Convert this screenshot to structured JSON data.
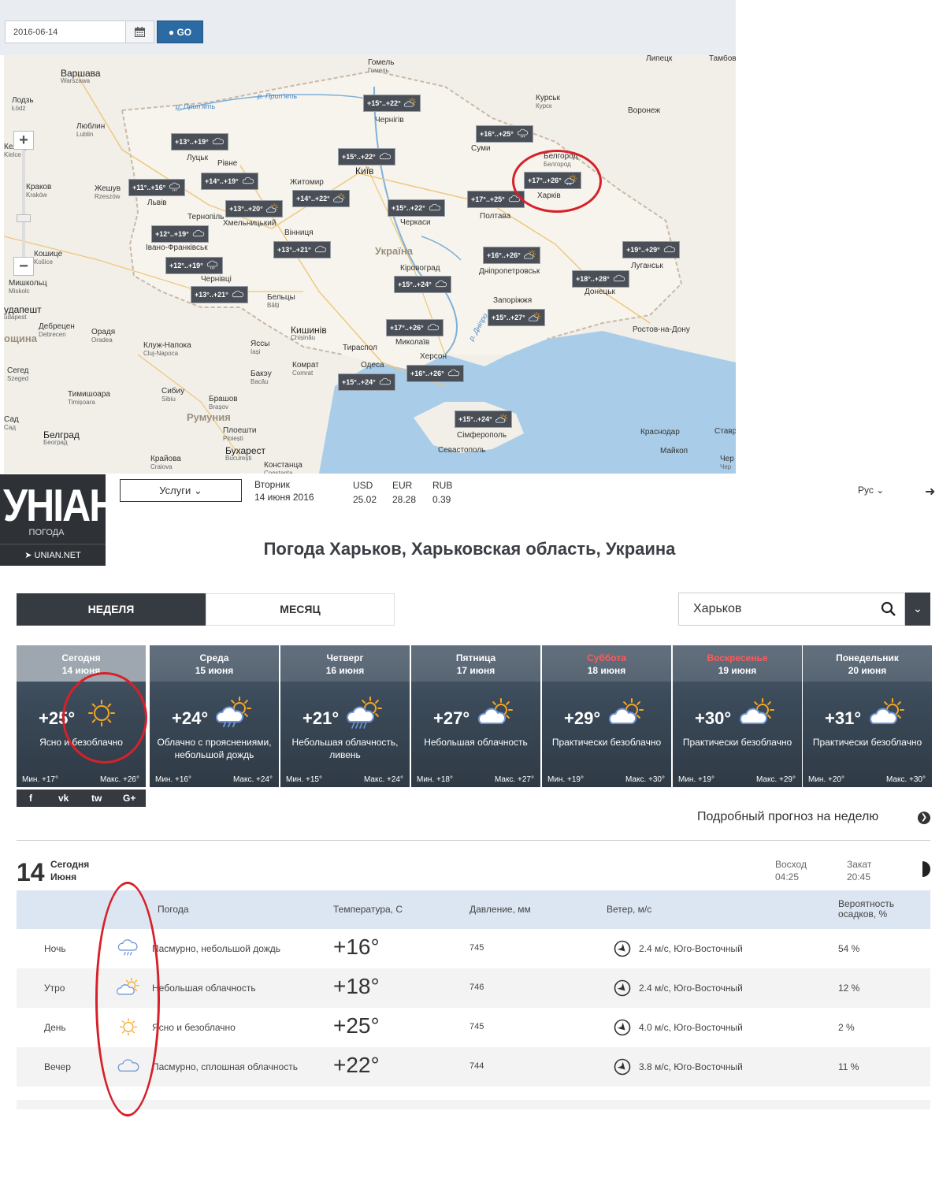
{
  "date_picker": {
    "value": "2016-06-14",
    "go_label": "GO"
  },
  "map": {
    "cities": [
      {
        "name": "Варшава",
        "sub": "Warszawa",
        "cls": "big"
      },
      {
        "name": "Лодзь",
        "sub": "Łódź",
        "cls": ""
      },
      {
        "name": "Люблин",
        "sub": "Lublin",
        "cls": ""
      },
      {
        "name": "Кельце",
        "sub": "Kielce",
        "cls": ""
      },
      {
        "name": "Краков",
        "sub": "Kraków",
        "cls": ""
      },
      {
        "name": "Жешув",
        "sub": "Rzeszów",
        "cls": ""
      },
      {
        "name": "Кошице",
        "sub": "Košice",
        "cls": ""
      },
      {
        "name": "Мишкольц",
        "sub": "Miskolc",
        "cls": ""
      },
      {
        "name": "удапешт",
        "sub": "udapest",
        "cls": "big"
      },
      {
        "name": "Дебрецен",
        "sub": "Debrecen",
        "cls": ""
      },
      {
        "name": "Орадя",
        "sub": "Oradea",
        "cls": ""
      },
      {
        "name": "Сегед",
        "sub": "Szeged",
        "cls": ""
      },
      {
        "name": "Тимишоара",
        "sub": "Timișoara",
        "cls": ""
      },
      {
        "name": "Белград",
        "sub": "Београд",
        "cls": "big"
      },
      {
        "name": "Клуж-Напока",
        "sub": "Cluj-Napoca",
        "cls": ""
      },
      {
        "name": "Сибиу",
        "sub": "Sibiu",
        "cls": ""
      },
      {
        "name": "Брашов",
        "sub": "Brașov",
        "cls": ""
      },
      {
        "name": "Румуния",
        "sub": "",
        "cls": "country"
      },
      {
        "name": "Плоешти",
        "sub": "Ploiești",
        "cls": ""
      },
      {
        "name": "Бухарест",
        "sub": "București",
        "cls": "big"
      },
      {
        "name": "Крайова",
        "sub": "Craiova",
        "cls": ""
      },
      {
        "name": "Констанца",
        "sub": "Constanța",
        "cls": ""
      },
      {
        "name": "Луцьк",
        "sub": "",
        "cls": ""
      },
      {
        "name": "Рівне",
        "sub": "",
        "cls": ""
      },
      {
        "name": "Львів",
        "sub": "",
        "cls": ""
      },
      {
        "name": "Тернопіль",
        "sub": "",
        "cls": ""
      },
      {
        "name": "Хмельницький",
        "sub": "",
        "cls": ""
      },
      {
        "name": "Івано-Франківськ",
        "sub": "",
        "cls": ""
      },
      {
        "name": "Чернівці",
        "sub": "",
        "cls": ""
      },
      {
        "name": "Житомир",
        "sub": "",
        "cls": ""
      },
      {
        "name": "Вінниця",
        "sub": "",
        "cls": ""
      },
      {
        "name": "Київ",
        "sub": "",
        "cls": "big"
      },
      {
        "name": "Чернігів",
        "sub": "",
        "cls": ""
      },
      {
        "name": "Гомель",
        "sub": "Гомель",
        "cls": ""
      },
      {
        "name": "Україна",
        "sub": "",
        "cls": "country"
      },
      {
        "name": "Черкаси",
        "sub": "",
        "cls": ""
      },
      {
        "name": "Кіровоград",
        "sub": "",
        "cls": ""
      },
      {
        "name": "Миколаїв",
        "sub": "",
        "cls": ""
      },
      {
        "name": "Одеса",
        "sub": "",
        "cls": ""
      },
      {
        "name": "Херсон",
        "sub": "",
        "cls": ""
      },
      {
        "name": "Кишинів",
        "sub": "Chișinău",
        "cls": "big"
      },
      {
        "name": "Бельцы",
        "sub": "Bălți",
        "cls": ""
      },
      {
        "name": "Яссы",
        "sub": "Iași",
        "cls": ""
      },
      {
        "name": "Бакэу",
        "sub": "Bacău",
        "cls": ""
      },
      {
        "name": "Тираспол",
        "sub": "",
        "cls": ""
      },
      {
        "name": "Комрат",
        "sub": "Comrat",
        "cls": ""
      },
      {
        "name": "Суми",
        "sub": "",
        "cls": ""
      },
      {
        "name": "Курськ",
        "sub": "Курск",
        "cls": ""
      },
      {
        "name": "Белгород",
        "sub": "Белгород",
        "cls": ""
      },
      {
        "name": "Харків",
        "sub": "",
        "cls": ""
      },
      {
        "name": "Полтава",
        "sub": "",
        "cls": ""
      },
      {
        "name": "Дніпропетровськ",
        "sub": "",
        "cls": ""
      },
      {
        "name": "Запоріжжя",
        "sub": "",
        "cls": ""
      },
      {
        "name": "Донецьк",
        "sub": "",
        "cls": ""
      },
      {
        "name": "Луганськ",
        "sub": "",
        "cls": ""
      },
      {
        "name": "Воронеж",
        "sub": "",
        "cls": ""
      },
      {
        "name": "Ростов-на-Дону",
        "sub": "",
        "cls": ""
      },
      {
        "name": "Краснодар",
        "sub": "",
        "cls": ""
      },
      {
        "name": "Майкоп",
        "sub": "",
        "cls": ""
      },
      {
        "name": "Сімферополь",
        "sub": "",
        "cls": ""
      },
      {
        "name": "Севастополь",
        "sub": "",
        "cls": ""
      },
      {
        "name": "Липецк",
        "sub": "",
        "cls": ""
      },
      {
        "name": "Тамбов",
        "sub": "",
        "cls": ""
      },
      {
        "name": "Ставро",
        "sub": "",
        "cls": ""
      },
      {
        "name": "Чер",
        "sub": "Чер",
        "cls": ""
      },
      {
        "name": "Сад",
        "sub": "Сад",
        "cls": ""
      },
      {
        "name": "ощина",
        "sub": "",
        "cls": "country"
      }
    ],
    "rivers": [
      "р. Прип'ять",
      "р. Прип'ять",
      "р. Дніпро"
    ],
    "labels": [
      {
        "text": "+15°..+22°",
        "icon": "cloud-sun"
      },
      {
        "text": "+16°..+25°",
        "icon": "cloud-rain"
      },
      {
        "text": "+13°..+19°",
        "icon": "cloud"
      },
      {
        "text": "+15°..+22°",
        "icon": "cloud"
      },
      {
        "text": "+17°..+26°",
        "icon": "cloud-rain-sun"
      },
      {
        "text": "+11°..+16°",
        "icon": "cloud-rain"
      },
      {
        "text": "+14°..+19°",
        "icon": "cloud"
      },
      {
        "text": "+14°..+22°",
        "icon": "cloud-sun"
      },
      {
        "text": "+17°..+25°",
        "icon": "cloud"
      },
      {
        "text": "+13°..+20°",
        "icon": "cloud-sun"
      },
      {
        "text": "+15°..+22°",
        "icon": "cloud"
      },
      {
        "text": "+12°..+19°",
        "icon": "cloud"
      },
      {
        "text": "+13°..+21°",
        "icon": "cloud"
      },
      {
        "text": "+16°..+26°",
        "icon": "cloud-sun"
      },
      {
        "text": "+19°..+29°",
        "icon": "cloud"
      },
      {
        "text": "+12°..+19°",
        "icon": "cloud-rain"
      },
      {
        "text": "+18°..+28°",
        "icon": "cloud"
      },
      {
        "text": "+15°..+24°",
        "icon": "cloud"
      },
      {
        "text": "+13°..+21°",
        "icon": "cloud"
      },
      {
        "text": "+17°..+26°",
        "icon": "cloud"
      },
      {
        "text": "+15°..+27°",
        "icon": "cloud-sun"
      },
      {
        "text": "+16°..+26°",
        "icon": "cloud"
      },
      {
        "text": "+15°..+24°",
        "icon": "cloud"
      },
      {
        "text": "+15°..+24°",
        "icon": "cloud-sun"
      }
    ]
  },
  "header": {
    "logo_text": "УНІАН",
    "logo_sub": "ПОГОДА",
    "logo_site": "UNIAN.NET",
    "services_label": "Услуги",
    "weekday": "Вторник",
    "date": "14 июня 2016",
    "currencies": [
      {
        "code": "USD",
        "value": "25.02"
      },
      {
        "code": "EUR",
        "value": "28.28"
      },
      {
        "code": "RUB",
        "value": "0.39"
      }
    ],
    "lang": "Рус"
  },
  "title": "Погода Харьков, Харьковская область, Украина",
  "tabs": {
    "week": "НЕДЕЛЯ",
    "month": "МЕСЯЦ"
  },
  "search": {
    "value": "Харьков"
  },
  "days": [
    {
      "day": "Сегодня",
      "date": "14  июня",
      "temp": "+25°",
      "desc": "Ясно и безоблачно",
      "min": "Мин. +17°",
      "max": "Макс. +26°",
      "icon": "sun",
      "weekend": false
    },
    {
      "day": "Среда",
      "date": "15  июня",
      "temp": "+24°",
      "desc": "Облачно с прояснениями, небольшой дождь",
      "min": "Мин. +16°",
      "max": "Макс. +24°",
      "icon": "cloud-rain-sun",
      "weekend": false
    },
    {
      "day": "Четверг",
      "date": "16  июня",
      "temp": "+21°",
      "desc": "Небольшая облачность, ливень",
      "min": "Мин. +15°",
      "max": "Макс. +24°",
      "icon": "cloud-shower-sun",
      "weekend": false
    },
    {
      "day": "Пятница",
      "date": "17  июня",
      "temp": "+27°",
      "desc": "Небольшая облачность",
      "min": "Мин. +18°",
      "max": "Макс. +27°",
      "icon": "cloud-sun",
      "weekend": false
    },
    {
      "day": "Суббота",
      "date": "18  июня",
      "temp": "+29°",
      "desc": "Практически безоблачно",
      "min": "Мин. +19°",
      "max": "Макс. +30°",
      "icon": "cloud-sun",
      "weekend": true
    },
    {
      "day": "Воскресенье",
      "date": "19  июня",
      "temp": "+30°",
      "desc": "Практически безоблачно",
      "min": "Мин. +19°",
      "max": "Макс. +29°",
      "icon": "cloud-sun",
      "weekend": true
    },
    {
      "day": "Понедельник",
      "date": "20  июня",
      "temp": "+31°",
      "desc": "Практически безоблачно",
      "min": "Мин. +20°",
      "max": "Макс. +30°",
      "icon": "cloud-sun",
      "weekend": false
    }
  ],
  "share": [
    "f",
    "vk",
    "tw",
    "G+"
  ],
  "detail_link": "Подробный прогноз на неделю",
  "today": {
    "num": "14",
    "label1": "Сегодня",
    "label2": "Июня",
    "sunrise_label": "Восход",
    "sunrise": "04:25",
    "sunset_label": "Закат",
    "sunset": "20:45"
  },
  "table": {
    "headers": {
      "weather": "Погода",
      "temp": "Температура, С",
      "pressure": "Давление, мм",
      "wind": "Ветер, м/с",
      "precip1": "Вероятность",
      "precip2": "осадков, %"
    },
    "rows": [
      {
        "part": "Ночь",
        "icon": "cloud-rain",
        "desc": "Пасмурно, небольшой дождь",
        "temp": "+16°",
        "pressure": "745",
        "wind": "2.4 м/с, Юго-Восточный",
        "precip": "54 %"
      },
      {
        "part": "Утро",
        "icon": "cloud-sun",
        "desc": "Небольшая облачность",
        "temp": "+18°",
        "pressure": "746",
        "wind": "2.4 м/с, Юго-Восточный",
        "precip": "12 %"
      },
      {
        "part": "День",
        "icon": "sun",
        "desc": "Ясно и безоблачно",
        "temp": "+25°",
        "pressure": "745",
        "wind": "4.0 м/с, Юго-Восточный",
        "precip": "2 %"
      },
      {
        "part": "Вечер",
        "icon": "cloud",
        "desc": "Пасмурно, сплошная облачность",
        "temp": "+22°",
        "pressure": "744",
        "wind": "3.8 м/с, Юго-Восточный",
        "precip": "11 %"
      }
    ]
  }
}
